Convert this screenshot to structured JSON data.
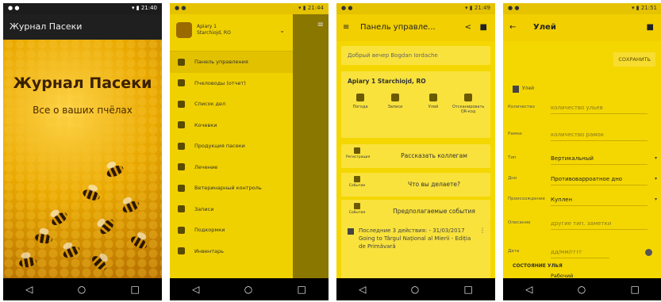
{
  "phone1": {
    "app_title": "Журнал Пасеки",
    "hero_title": "Журнал Пасеки",
    "hero_subtitle": "Все о ваших пчёлах"
  },
  "phone2": {
    "apiary_name": "Apiary 1",
    "apiary_place": "Starchiojd, RO",
    "menu": [
      "Панель управления",
      "Пчеловоды (отчет)",
      "Список дел",
      "Кочевки",
      "Продукция пасеки",
      "Лечение",
      "Ветеринарный контроль",
      "Записи",
      "Подкормки",
      "Инвентарь"
    ]
  },
  "phone3": {
    "title": "Панель управле...",
    "greeting": "Добрый вечер Bogdan Iordache",
    "apiary_title": "Apiary 1 Starchiojd, RO",
    "tiles": [
      "Погода",
      "Записи",
      "Улей",
      "Отсканировать QR-код"
    ],
    "actions": [
      {
        "icon_label": "Регистрация",
        "label": "Рассказать коллегам"
      },
      {
        "icon_label": "Событие",
        "label": "Что вы делаете?"
      },
      {
        "icon_label": "События",
        "label": "Предполагаемые события"
      }
    ],
    "recent": "Последние 3 действия: - 31/03/2017 Going to Târgul Național al Mierii - Ediția de Primăvară"
  },
  "phone4": {
    "title": "Улей",
    "save_label": "СОХРАНИТЬ",
    "hive_label": "Улей",
    "fields": [
      {
        "label": "Количество",
        "value": "количество ульев",
        "placeholder": true
      },
      {
        "label": "Рамки",
        "value": "количество рамок",
        "placeholder": true
      },
      {
        "label": "Тип",
        "value": "Вертикальный",
        "placeholder": false
      },
      {
        "label": "Дно",
        "value": "Противоварроатное дно",
        "placeholder": false
      },
      {
        "label": "Происхождение",
        "value": "Куплен",
        "placeholder": false
      },
      {
        "label": "Описание",
        "value": "другие тип. заметки",
        "placeholder": true
      },
      {
        "label": "Дата",
        "value": "дд/мм/гггг",
        "placeholder": true
      }
    ],
    "state_label": "СОСТОЯНИЕ УЛЬЯ",
    "state_value": "Рабочий"
  },
  "colors": {
    "yellow": "#f4d700",
    "bar_yellow": "#f2cf00",
    "dark": "#1f1f1f"
  }
}
